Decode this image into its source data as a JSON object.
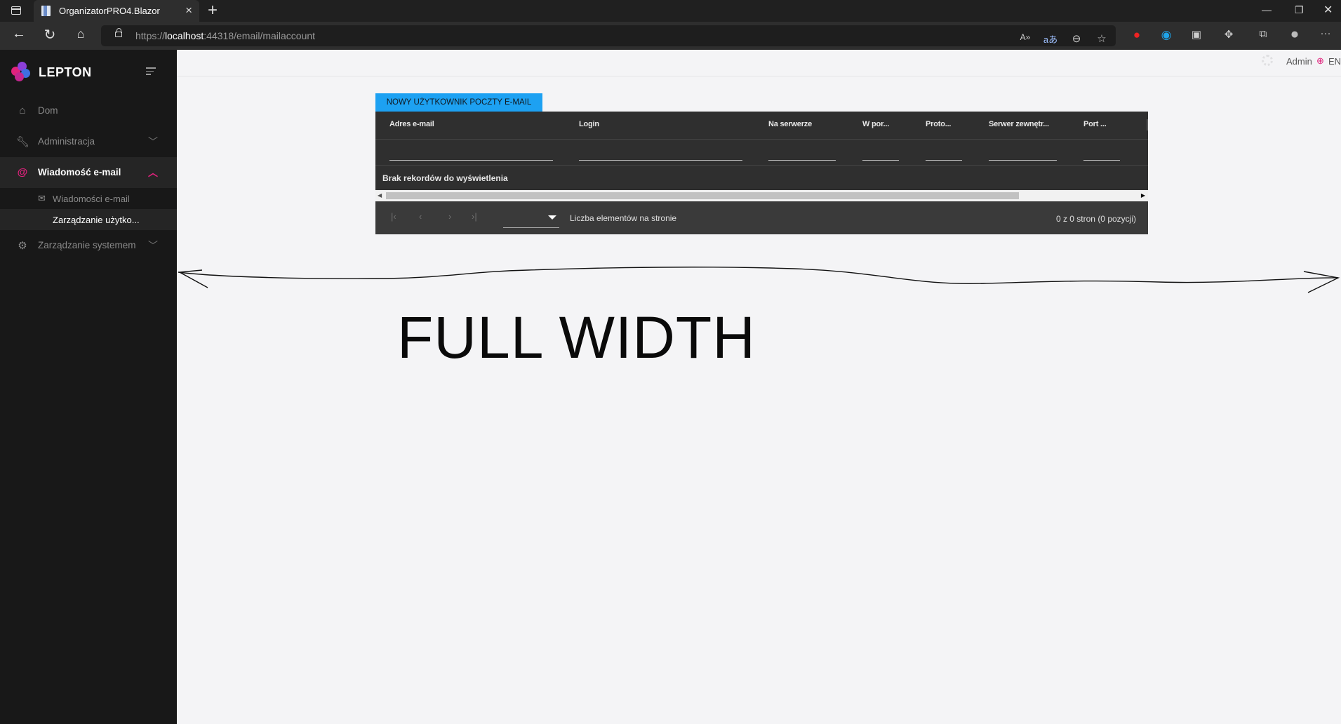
{
  "browser": {
    "tab_title": "OrganizatorPRO4.Blazor",
    "url_scheme": "https://",
    "url_host": "localhost",
    "url_rest": ":44318/email/mailaccount"
  },
  "sidebar": {
    "brand": "LEPTON",
    "items": [
      {
        "label": "Dom",
        "icon": "home-icon"
      },
      {
        "label": "Administracja",
        "icon": "wrench-icon"
      },
      {
        "label": "Wiadomość e-mail",
        "icon": "at-icon"
      },
      {
        "label": "Zarządzanie systemem",
        "icon": "gears-icon"
      }
    ],
    "subitems": [
      {
        "label": "Wiadomości e-mail",
        "icon": "mail-icon"
      },
      {
        "label": "Zarządzanie użytko..."
      }
    ]
  },
  "topbar": {
    "user": "Admin",
    "language": "EN"
  },
  "content": {
    "new_button": "NOWY UŻYTKOWNIK POCZTY E-MAIL",
    "columns": [
      "Adres e-mail",
      "Login",
      "Na serwerze",
      "W por...",
      "Proto...",
      "Serwer zewnętr...",
      "Port ..."
    ],
    "empty_message": "Brak rekordów do wyświetlenia",
    "pager": {
      "page_size_label": "Liczba elementów na stronie",
      "info": "0 z 0 stron (0 pozycji)"
    }
  },
  "annotation": {
    "text": "FULL WIDTH"
  },
  "colors": {
    "accent": "#e0227c",
    "button": "#1da1f2",
    "sidebar_bg": "#181818"
  }
}
